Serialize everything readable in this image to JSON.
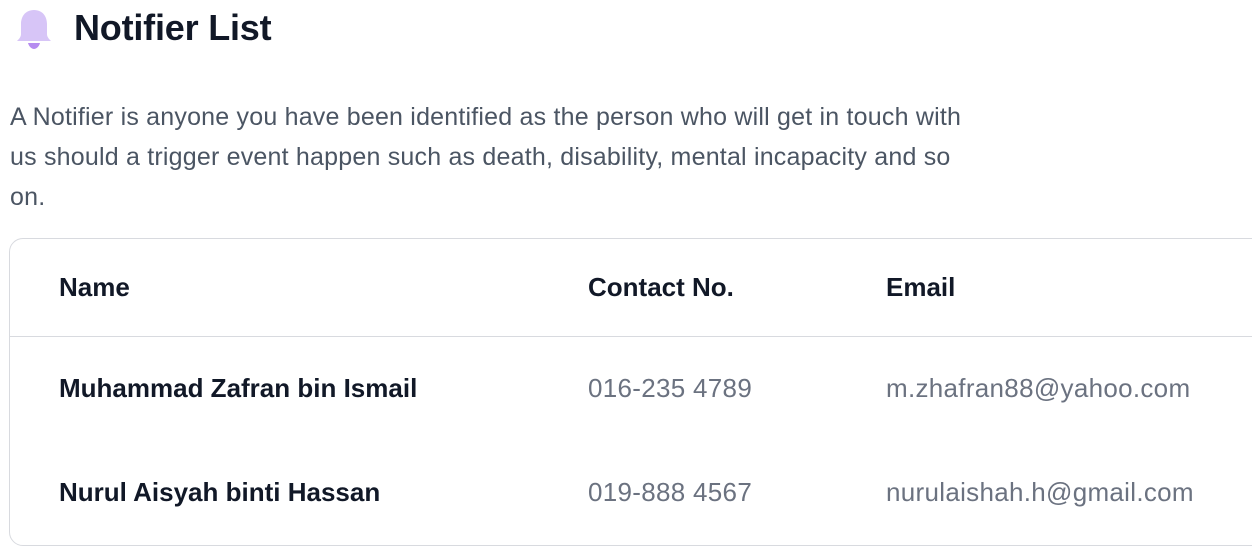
{
  "header": {
    "title": "Notifier List",
    "icon": "bell-icon",
    "icon_color": "#d7c5f7"
  },
  "description": "A Notifier is anyone you have been identified as the person who will get in touch with us should a trigger event happen such as death, disability, mental incapacity and so on.",
  "table": {
    "columns": [
      "Name",
      "Contact No.",
      "Email"
    ],
    "rows": [
      {
        "name": "Muhammad Zafran bin Ismail",
        "contact": "016-235 4789",
        "email": "m.zhafran88@yahoo.com"
      },
      {
        "name": "Nurul Aisyah binti Hassan",
        "contact": "019-888 4567",
        "email": "nurulaishah.h@gmail.com"
      }
    ]
  }
}
